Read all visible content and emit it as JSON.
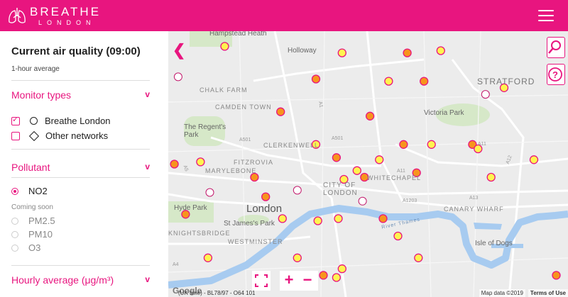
{
  "brand": {
    "title": "BREATHE",
    "subtitle": "LONDON"
  },
  "sidebar": {
    "title": "Current air quality (09:00)",
    "subtitle": "1-hour average",
    "monitor_types": {
      "label": "Monitor types",
      "options": [
        {
          "label": "Breathe London",
          "checked": true
        },
        {
          "label": "Other networks",
          "checked": false
        }
      ]
    },
    "pollutant": {
      "label": "Pollutant",
      "selected": "NO2",
      "coming_soon_label": "Coming soon",
      "coming_soon": [
        "PM2.5",
        "PM10",
        "O3"
      ]
    },
    "hourly_label": "Hourly average (μg/m³)"
  },
  "map": {
    "labels": {
      "hampstead": "Hampstead Heath",
      "holloway": "Holloway",
      "stratford": "STRATFORD",
      "chalk_farm": "CHALK FARM",
      "camden": "CAMDEN TOWN",
      "regents_park": "The Regent's Park",
      "victoria_park": "Victoria Park",
      "clerkenwell": "CLERKENWELL",
      "fitzrovia": "FITZROVIA",
      "marylebone": "MARYLEBONE",
      "city": "CITY OF LONDON",
      "whitechapel": "WHITECHAPEL",
      "london": "London",
      "hyde_park": "Hyde Park",
      "knightsbridge": "KNIGHTSBRIDGE",
      "st_james": "St James's Park",
      "westminster": "WESTMINSTER",
      "canary": "CANARY WHARF",
      "isle_dogs": "Isle of Dogs",
      "river": "River Thames",
      "a1": "A1",
      "a501": "A501",
      "a11": "A11",
      "a12": "A12",
      "a1203": "A1203",
      "a5": "A5",
      "a4": "A4",
      "a13": "A13"
    },
    "attribution_left": "(UK time) - BL78/97 - O64 101",
    "attribution_right": "Map data ©2019",
    "terms": "Terms of Use",
    "google": "Google",
    "markers": [
      {
        "lng": -0.172,
        "lat": 51.56,
        "color": "yellow"
      },
      {
        "lng": -0.109,
        "lat": 51.557,
        "color": "yellow"
      },
      {
        "lng": -0.074,
        "lat": 51.557,
        "color": "orange"
      },
      {
        "lng": -0.056,
        "lat": 51.558,
        "color": "yellow"
      },
      {
        "lng": -0.197,
        "lat": 51.546,
        "color": "hollow"
      },
      {
        "lng": -0.123,
        "lat": 51.545,
        "color": "orange"
      },
      {
        "lng": -0.084,
        "lat": 51.544,
        "color": "yellow"
      },
      {
        "lng": -0.065,
        "lat": 51.544,
        "color": "orange"
      },
      {
        "lng": -0.022,
        "lat": 51.541,
        "color": "yellow"
      },
      {
        "lng": -0.032,
        "lat": 51.538,
        "color": "hollow"
      },
      {
        "lng": -0.142,
        "lat": 51.53,
        "color": "orange"
      },
      {
        "lng": -0.094,
        "lat": 51.528,
        "color": "orange"
      },
      {
        "lng": -0.123,
        "lat": 51.515,
        "color": "yellow"
      },
      {
        "lng": -0.076,
        "lat": 51.515,
        "color": "orange"
      },
      {
        "lng": -0.061,
        "lat": 51.515,
        "color": "yellow"
      },
      {
        "lng": -0.039,
        "lat": 51.515,
        "color": "orange"
      },
      {
        "lng": -0.036,
        "lat": 51.513,
        "color": "yellow"
      },
      {
        "lng": -0.199,
        "lat": 51.506,
        "color": "orange"
      },
      {
        "lng": -0.185,
        "lat": 51.507,
        "color": "yellow"
      },
      {
        "lng": -0.112,
        "lat": 51.509,
        "color": "orange"
      },
      {
        "lng": -0.089,
        "lat": 51.508,
        "color": "yellow"
      },
      {
        "lng": -0.006,
        "lat": 51.508,
        "color": "yellow"
      },
      {
        "lng": -0.101,
        "lat": 51.503,
        "color": "yellow"
      },
      {
        "lng": -0.097,
        "lat": 51.5,
        "color": "orange"
      },
      {
        "lng": -0.108,
        "lat": 51.499,
        "color": "yellow"
      },
      {
        "lng": -0.156,
        "lat": 51.5,
        "color": "orange"
      },
      {
        "lng": -0.069,
        "lat": 51.502,
        "color": "orange"
      },
      {
        "lng": -0.029,
        "lat": 51.5,
        "color": "yellow"
      },
      {
        "lng": -0.18,
        "lat": 51.493,
        "color": "hollow"
      },
      {
        "lng": -0.133,
        "lat": 51.494,
        "color": "hollow"
      },
      {
        "lng": -0.15,
        "lat": 51.491,
        "color": "orange"
      },
      {
        "lng": -0.098,
        "lat": 51.489,
        "color": "hollow"
      },
      {
        "lng": -0.193,
        "lat": 51.483,
        "color": "orange"
      },
      {
        "lng": -0.141,
        "lat": 51.481,
        "color": "yellow"
      },
      {
        "lng": -0.122,
        "lat": 51.48,
        "color": "yellow"
      },
      {
        "lng": -0.111,
        "lat": 51.481,
        "color": "yellow"
      },
      {
        "lng": -0.087,
        "lat": 51.481,
        "color": "orange"
      },
      {
        "lng": -0.079,
        "lat": 51.473,
        "color": "yellow"
      },
      {
        "lng": -0.181,
        "lat": 51.463,
        "color": "yellow"
      },
      {
        "lng": -0.133,
        "lat": 51.463,
        "color": "yellow"
      },
      {
        "lng": -0.068,
        "lat": 51.463,
        "color": "yellow"
      },
      {
        "lng": -0.109,
        "lat": 51.458,
        "color": "yellow"
      },
      {
        "lng": -0.119,
        "lat": 51.455,
        "color": "orange"
      },
      {
        "lng": -0.112,
        "lat": 51.454,
        "color": "yellow"
      },
      {
        "lng": 0.006,
        "lat": 51.455,
        "color": "orange"
      }
    ]
  },
  "colors": {
    "brand": "#e8157f",
    "marker_yellow": "#fff44f",
    "marker_orange": "#f7941d",
    "river": "#a7cbf0",
    "park": "#d6e8c8"
  }
}
